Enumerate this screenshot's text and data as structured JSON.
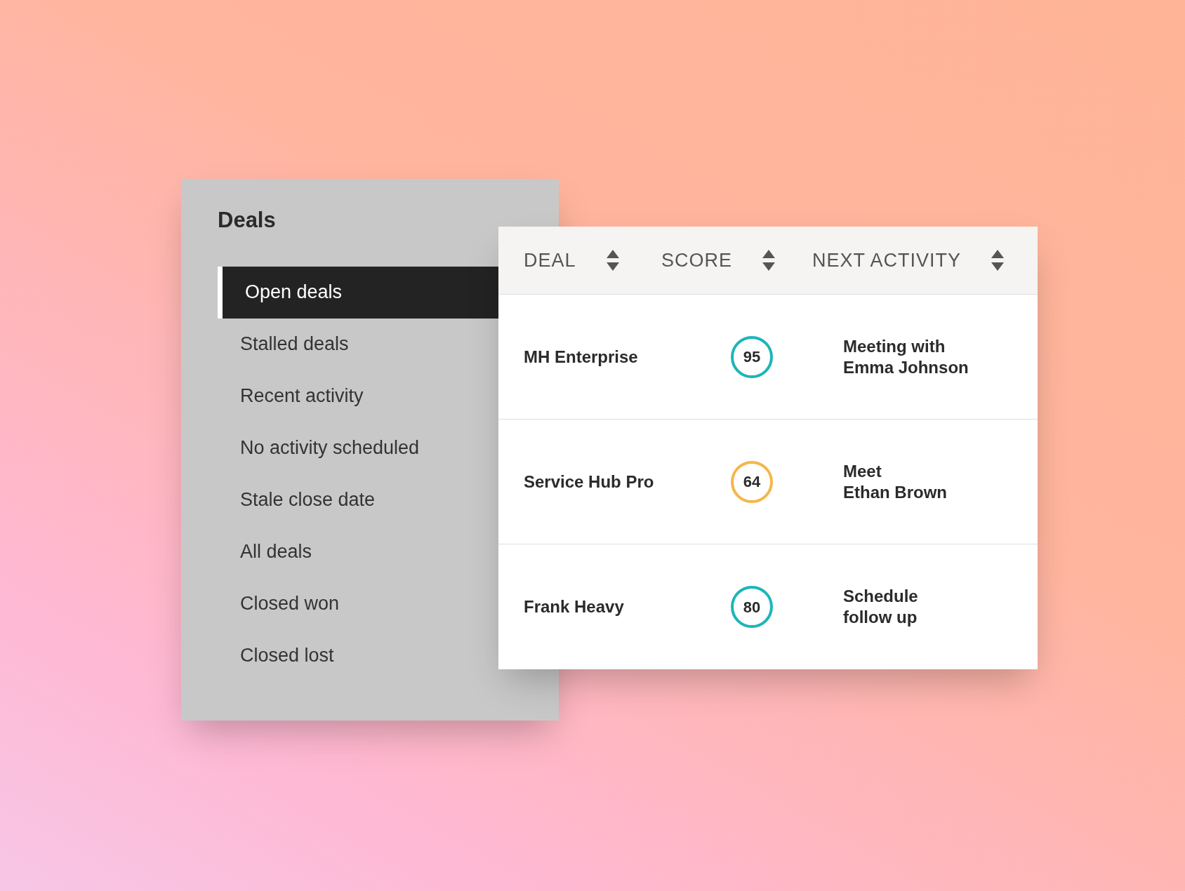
{
  "sidebar": {
    "title": "Deals",
    "items": [
      {
        "label": "Open deals",
        "selected": true
      },
      {
        "label": "Stalled deals",
        "selected": false
      },
      {
        "label": "Recent activity",
        "selected": false
      },
      {
        "label": "No activity scheduled",
        "selected": false
      },
      {
        "label": "Stale close date",
        "selected": false
      },
      {
        "label": "All deals",
        "selected": false
      },
      {
        "label": "Closed won",
        "selected": false
      },
      {
        "label": "Closed lost",
        "selected": false
      }
    ]
  },
  "table": {
    "columns": [
      "DEAL",
      "SCORE",
      "NEXT ACTIVITY"
    ],
    "rows": [
      {
        "deal": "MH Enterprise",
        "score": "95",
        "color": "#1db5b8",
        "next_activity": [
          "Meeting with",
          "Emma Johnson"
        ]
      },
      {
        "deal": "Service Hub Pro",
        "score": "64",
        "color": "#f5b64a",
        "next_activity": [
          "Meet",
          "Ethan Brown"
        ]
      },
      {
        "deal": "Frank Heavy",
        "score": "80",
        "color": "#1db5b8",
        "next_activity": [
          "Schedule",
          "follow up"
        ]
      }
    ]
  }
}
